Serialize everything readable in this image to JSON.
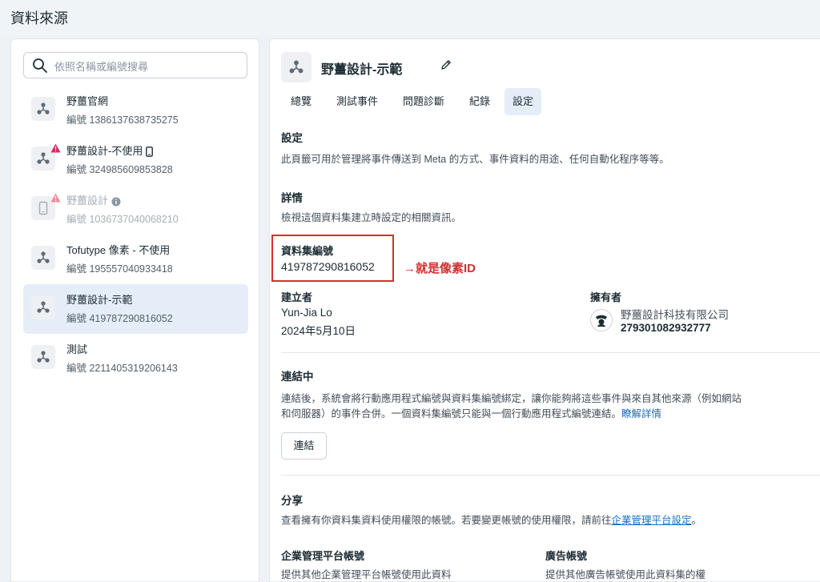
{
  "page": {
    "title": "資料來源"
  },
  "search": {
    "placeholder": "依照名稱或編號搜尋"
  },
  "sources": [
    {
      "name": "野薑官網",
      "id_line": "編號 1386137638735275"
    },
    {
      "name": "野薑設計-不使用",
      "id_line": "編號 324985609853828",
      "warning": true,
      "badge": "mobile-icon"
    },
    {
      "name": "野薑設計",
      "id_line": "編號 1036737040068210",
      "warning": true,
      "badge": "info-icon",
      "disabled": true
    },
    {
      "name": "Tofutype 像素 - 不使用",
      "id_line": "編號 195557040933418"
    },
    {
      "name": "野薑設計-示範",
      "id_line": "編號 419787290816052",
      "selected": true
    },
    {
      "name": "測試",
      "id_line": "編號 2211405319206143"
    }
  ],
  "detail": {
    "title": "野薑設計-示範",
    "tabs": [
      "總覽",
      "測試事件",
      "問題診斷",
      "紀錄",
      "設定"
    ],
    "active_tab": "設定",
    "settings": {
      "title": "設定",
      "description": "此頁籤可用於管理將事件傳送到 Meta 的方式、事件資料的用途、任何自動化程序等等。"
    },
    "details": {
      "title": "詳情",
      "description": "檢視這個資料集建立時設定的相關資訊。"
    },
    "dataset_id": {
      "label": "資料集編號",
      "value": "419787290816052"
    },
    "annotation": "→就是像素ID",
    "creator": {
      "label": "建立者",
      "name": "Yun-Jia Lo",
      "date": "2024年5月10日"
    },
    "owner": {
      "label": "擁有者",
      "name": "野薑設計科技有限公司",
      "id": "279301082932777"
    },
    "connect": {
      "title": "連結中",
      "line1": "連結後，系統會將行動應用程式編號與資料集編號綁定，讓你能夠將這些事件與來自其他來源（例如網站",
      "line2": "和伺服器）的事件合併。一個資料集編號只能與一個行動應用程式編號連結。",
      "learn_more": "瞭解詳情",
      "button": "連結"
    },
    "share": {
      "title": "分享",
      "text_before": "查看擁有你資料集資料使用權限的帳號。若要變更帳號的使用權限，請前往",
      "link": "企業管理平台設定",
      "text_after": "。",
      "business_title": "企業管理平台帳號",
      "business_desc": "提供其他企業管理平台帳號使用此資料",
      "ad_title": "廣告帳號",
      "ad_desc": "提供其他廣告帳號使用此資料集的權"
    }
  },
  "colors": {
    "accent": "#1a6ec0",
    "selected_bg": "#e5eef8",
    "highlight": "#d32f2f"
  }
}
